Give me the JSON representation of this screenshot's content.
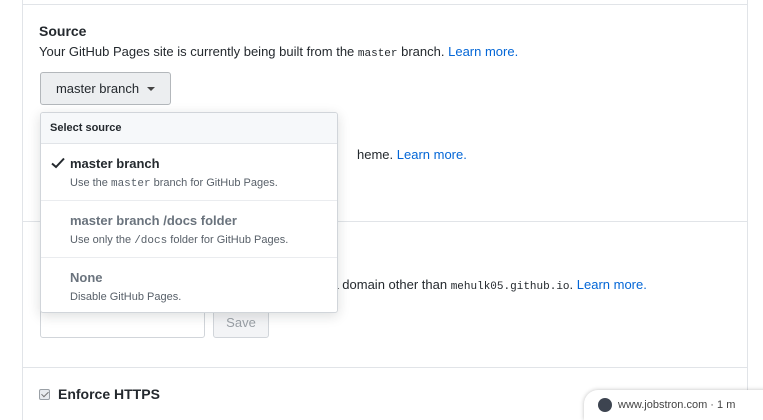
{
  "source": {
    "title": "Source",
    "desc_prefix": "Your GitHub Pages site is currently being built from the ",
    "desc_code": "master",
    "desc_suffix": " branch. ",
    "learn_more": "Learn more.",
    "button_label": "master branch"
  },
  "dropdown": {
    "header": "Select source",
    "items": [
      {
        "title": "master branch",
        "sub_prefix": "Use the ",
        "sub_code": "master",
        "sub_suffix": " branch for GitHub Pages.",
        "selected": true
      },
      {
        "title": "master branch /docs folder",
        "sub_prefix": "Use only the ",
        "sub_code": "/docs",
        "sub_suffix": " folder for GitHub Pages.",
        "selected": false
      },
      {
        "title": "None",
        "sub_prefix": "Disable GitHub Pages.",
        "sub_code": "",
        "sub_suffix": "",
        "selected": false
      }
    ]
  },
  "theme": {
    "visible_text": "heme. ",
    "learn_more": "Learn more."
  },
  "custom_domain": {
    "visible_prefix": "m a domain other than ",
    "domain": "mehulk05.github.io",
    "suffix": ". ",
    "learn_more": "Learn more.",
    "save_label": "Save"
  },
  "https": {
    "label": "Enforce HTTPS",
    "checked": true
  },
  "watermark": {
    "text": "www.jobstron.com · 1 m"
  },
  "colors": {
    "link": "#0366d6",
    "text": "#24292e",
    "muted": "#586069",
    "border": "#e1e4e8"
  }
}
